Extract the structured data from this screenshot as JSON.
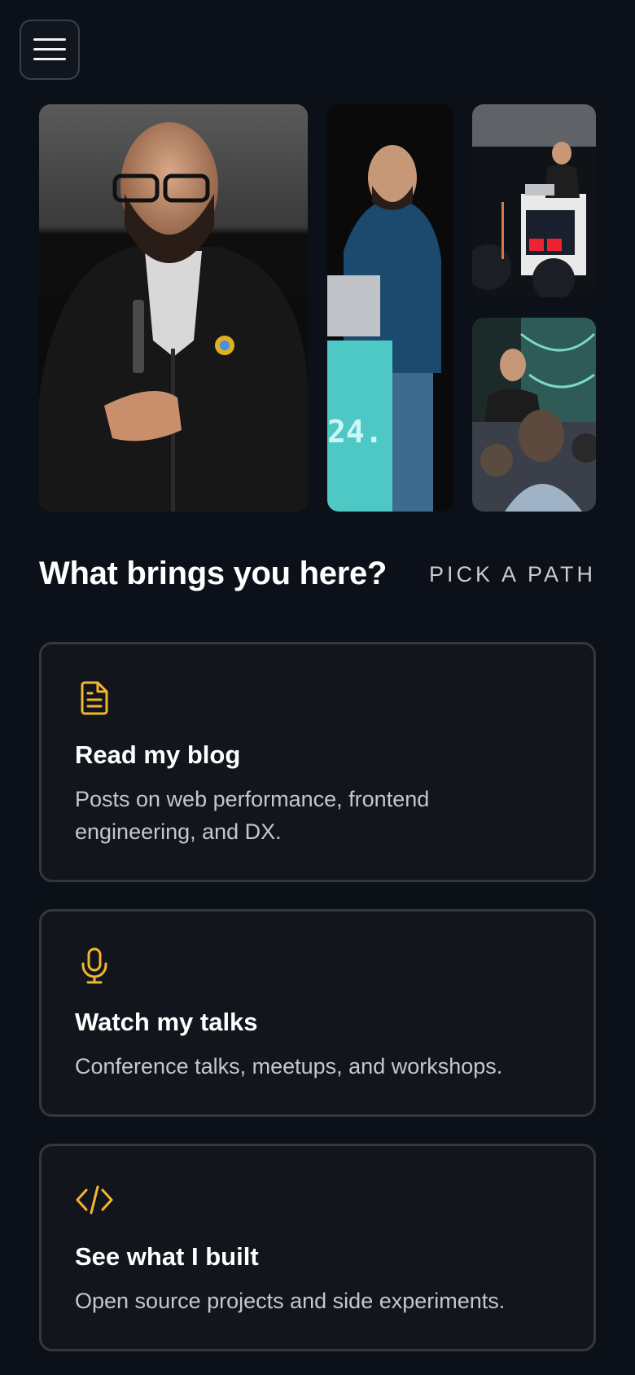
{
  "header": {
    "menu_icon": "hamburger-menu-icon"
  },
  "gallery": {
    "photos": [
      "speaker-portrait-photo",
      "speaker-on-stage-photo",
      "speaker-at-podium-photo",
      "speaker-at-conference-photo"
    ]
  },
  "paths": {
    "heading": "What brings you here?",
    "subheading": "PICK A PATH",
    "cards": [
      {
        "icon": "document-icon",
        "title": "Read my blog",
        "description": "Posts on web performance, frontend engineering, and DX."
      },
      {
        "icon": "microphone-icon",
        "title": "Watch my talks",
        "description": "Conference talks, meetups, and workshops."
      },
      {
        "icon": "code-icon",
        "title": "See what I built",
        "description": "Open source projects and side experiments."
      }
    ]
  },
  "colors": {
    "background": "#0c1018",
    "card_background": "#12151c",
    "card_border": "#33373e",
    "accent": "#f3b631",
    "text_primary": "#ffffff",
    "text_secondary": "#c4c7cd"
  }
}
